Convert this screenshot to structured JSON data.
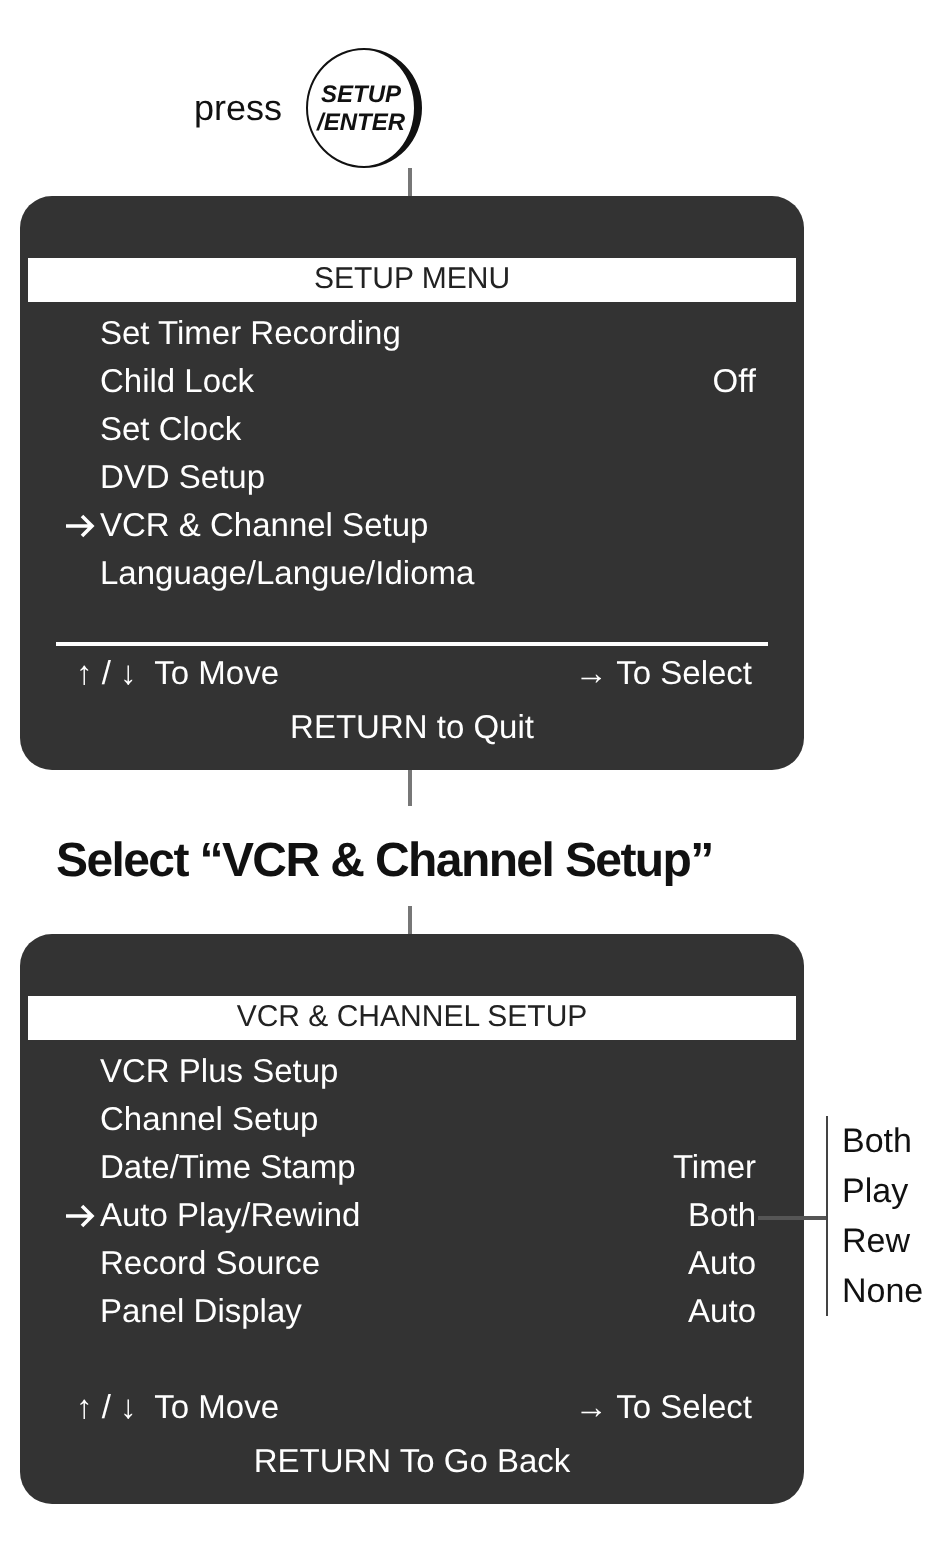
{
  "remote_button": {
    "prefix": "press",
    "label_lines": [
      "SETUP",
      "/ENTER"
    ]
  },
  "menus": [
    {
      "title": "SETUP MENU",
      "divider": true,
      "items": [
        {
          "label": "Set Timer Recording",
          "selected": false
        },
        {
          "label": "Child Lock",
          "value": "Off",
          "selected": false
        },
        {
          "label": "Set Clock",
          "selected": false
        },
        {
          "label": "DVD Setup",
          "selected": false
        },
        {
          "label": "VCR & Channel Setup",
          "selected": true
        },
        {
          "label": "Language/Langue/Idioma",
          "selected": false
        }
      ],
      "footer": {
        "move_keys": "↑ / ↓",
        "move": "To Move",
        "select_key": "→",
        "select": "To Select",
        "back": "RETURN to Quit"
      }
    },
    {
      "title": "VCR & CHANNEL SETUP",
      "divider": false,
      "items": [
        {
          "label": "VCR Plus Setup",
          "selected": false
        },
        {
          "label": "Channel Setup",
          "selected": false
        },
        {
          "label": "Date/Time Stamp",
          "value": "Timer",
          "selected": false
        },
        {
          "label": "Auto Play/Rewind",
          "value": "Both",
          "selected": true,
          "options": [
            "Both",
            "Play",
            "Rew",
            "None"
          ]
        },
        {
          "label": "Record Source",
          "value": "Auto",
          "selected": false
        },
        {
          "label": "Panel Display",
          "value": "Auto",
          "selected": false
        }
      ],
      "footer": {
        "move_keys": "↑ / ↓",
        "move": "To Move",
        "select_key": "→",
        "select": "To Select",
        "back": "RETURN To Go Back"
      }
    }
  ],
  "caption": "Select “VCR & Channel Setup”"
}
